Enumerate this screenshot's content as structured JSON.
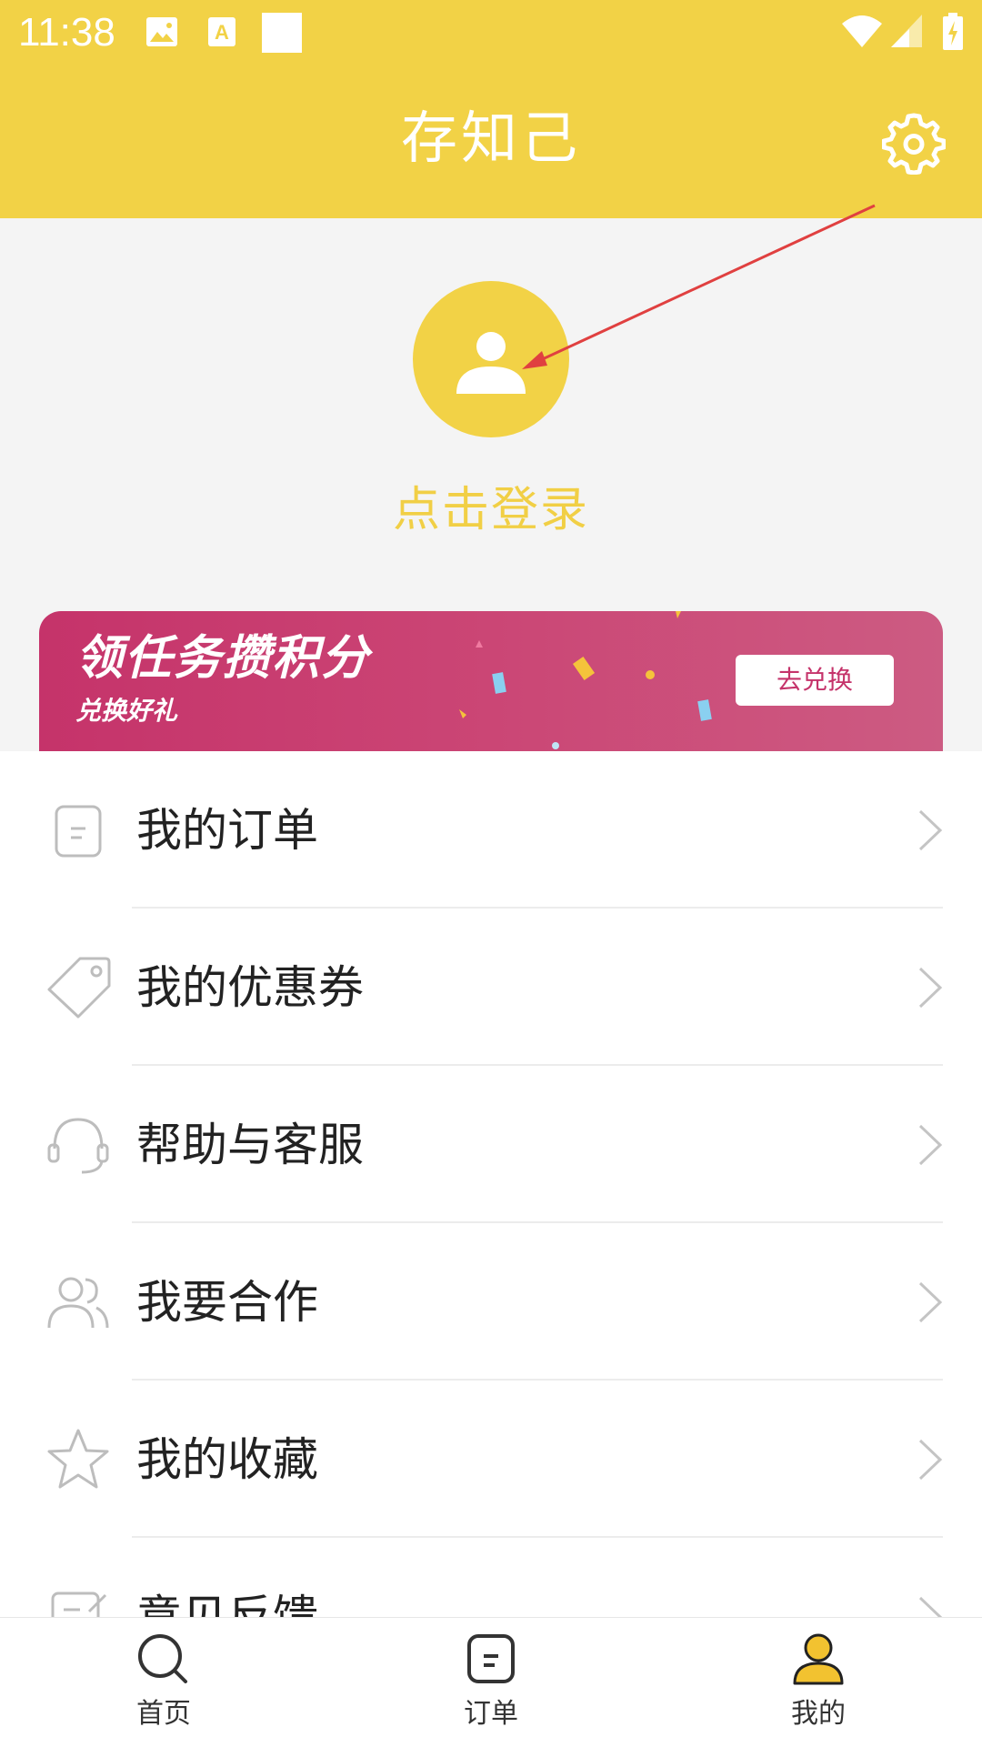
{
  "status_bar": {
    "time": "11:38",
    "left_icons": [
      "image-icon",
      "font-icon",
      "blank-square-icon"
    ],
    "right_icons": [
      "wifi-icon",
      "signal-icon",
      "battery-charging-icon"
    ]
  },
  "header": {
    "title": "存知己",
    "settings_icon": "gear-icon",
    "background_color": "#f2d246"
  },
  "profile": {
    "avatar_icon": "user-icon",
    "login_text": "点击登录",
    "accent_color": "#f1cf45"
  },
  "banner": {
    "title": "领任务攒积分",
    "subtitle": "兑换好礼",
    "button_label": "去兑换",
    "color": "#c5336a"
  },
  "menu": {
    "items": [
      {
        "label": "我的订单",
        "icon": "order-icon"
      },
      {
        "label": "我的优惠券",
        "icon": "coupon-tag-icon"
      },
      {
        "label": "帮助与客服",
        "icon": "headset-icon"
      },
      {
        "label": "我要合作",
        "icon": "users-icon"
      },
      {
        "label": "我的收藏",
        "icon": "star-icon"
      },
      {
        "label": "意见反馈",
        "icon": "feedback-icon"
      }
    ]
  },
  "bottom_nav": {
    "tabs": [
      {
        "label": "首页",
        "icon": "search-icon",
        "active": false
      },
      {
        "label": "订单",
        "icon": "order-icon",
        "active": false
      },
      {
        "label": "我的",
        "icon": "user-icon",
        "active": true
      }
    ]
  }
}
